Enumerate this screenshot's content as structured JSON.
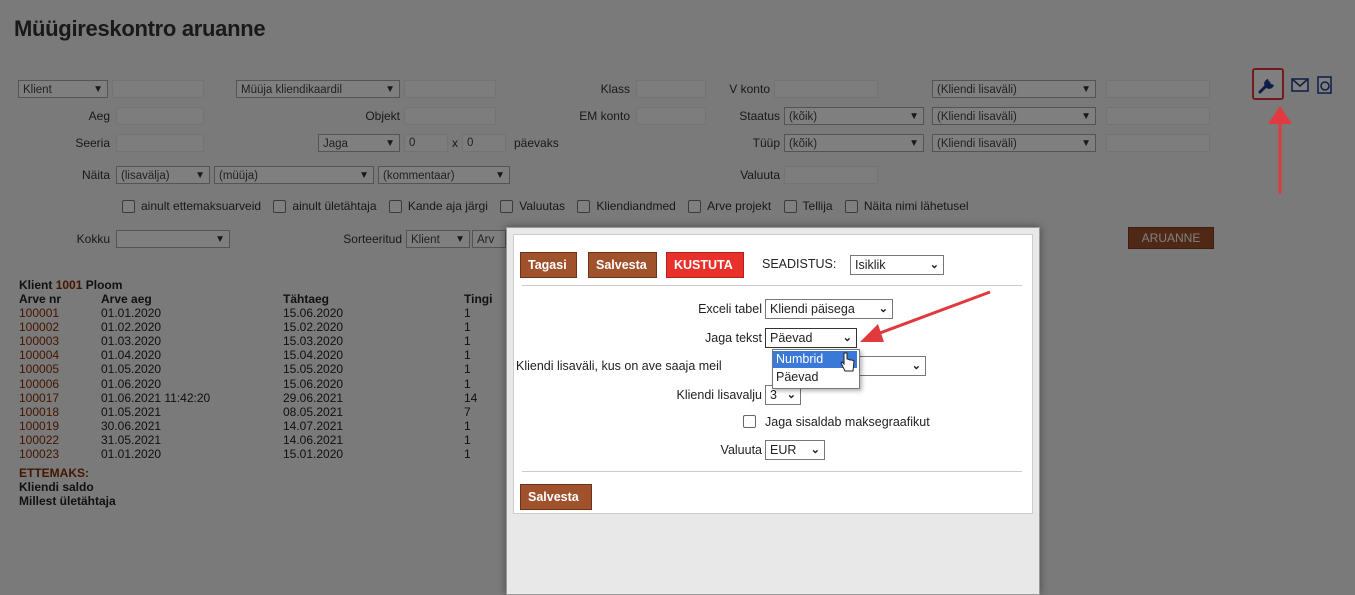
{
  "page": {
    "title": "Müügireskontro aruanne"
  },
  "filters": {
    "row1": {
      "klient_select": "Klient",
      "myyja_select": "Müüja kliendikaardil",
      "klass_label": "Klass",
      "v_konto_label": "V konto",
      "kliendi_lisavali_1": "(Kliendi lisaväli)"
    },
    "row2": {
      "aeg_label": "Aeg",
      "objekt_label": "Objekt",
      "em_konto_label": "EM konto",
      "staatus_label": "Staatus",
      "staatus_value": "(kõik)",
      "kliendi_lisavali_2": "(Kliendi lisaväli)"
    },
    "row3": {
      "seeria_label": "Seeria",
      "jaga_select": "Jaga",
      "jaga_n1": "0",
      "x_label": "x",
      "jaga_n2": "0",
      "paevaks_label": "päevaks",
      "tyyp_label": "Tüüp",
      "tyyp_value": "(kõik)",
      "kliendi_lisavali_3": "(Kliendi lisaväli)"
    },
    "row4": {
      "naita_label": "Näita",
      "lisavalja": "(lisavälja)",
      "myyja": "(müüja)",
      "kommentaar": "(kommentaar)",
      "valuuta_label": "Valuuta"
    },
    "checkboxes": [
      "ainult ettemaksuarveid",
      "ainult ületähtaja",
      "Kande aja järgi",
      "Valuutas",
      "Kliendiandmed",
      "Arve projekt",
      "Tellija",
      "Näita nimi lähetusel"
    ],
    "row6": {
      "kokku_label": "Kokku",
      "sorteeritud_label": "Sorteeritud",
      "sort_value": "Klient",
      "sort_value2": "Arv",
      "aruanne_button": "ARUANNE"
    }
  },
  "report": {
    "client_prefix": "Klient",
    "client_code": "1001",
    "client_name": "Ploom",
    "headers": [
      "Arve nr",
      "Arve aeg",
      "Tähtaeg",
      "Tingi"
    ],
    "rows": [
      {
        "nr": "100001",
        "aeg": "01.01.2020",
        "tahtaeg": "15.06.2020",
        "t": "1"
      },
      {
        "nr": "100002",
        "aeg": "01.02.2020",
        "tahtaeg": "15.02.2020",
        "t": "1"
      },
      {
        "nr": "100003",
        "aeg": "01.03.2020",
        "tahtaeg": "15.03.2020",
        "t": "1"
      },
      {
        "nr": "100004",
        "aeg": "01.04.2020",
        "tahtaeg": "15.04.2020",
        "t": "1"
      },
      {
        "nr": "100005",
        "aeg": "01.05.2020",
        "tahtaeg": "15.05.2020",
        "t": "1"
      },
      {
        "nr": "100006",
        "aeg": "01.06.2020",
        "tahtaeg": "15.06.2020",
        "t": "1"
      },
      {
        "nr": "100017",
        "aeg": "01.06.2021 11:42:20",
        "tahtaeg": "29.06.2021",
        "t": "14"
      },
      {
        "nr": "100018",
        "aeg": "01.05.2021",
        "tahtaeg": "08.05.2021",
        "t": "7"
      },
      {
        "nr": "100019",
        "aeg": "30.06.2021",
        "tahtaeg": "14.07.2021",
        "t": "1"
      },
      {
        "nr": "100022",
        "aeg": "31.05.2021",
        "tahtaeg": "14.06.2021",
        "t": "1"
      },
      {
        "nr": "100023",
        "aeg": "01.01.2020",
        "tahtaeg": "15.01.2020",
        "t": "1"
      }
    ],
    "ettemaks": "ETTEMAKS:",
    "kliendi_saldo": "Kliendi saldo",
    "millest": "Millest ületähtaja"
  },
  "dialog": {
    "tagasi": "Tagasi",
    "salvesta_top": "Salvesta",
    "kustuta": "KUSTUTA",
    "seadistus_label": "SEADISTUS:",
    "seadistus_value": "Isiklik",
    "exceli_label": "Exceli tabel",
    "exceli_value": "Kliendi päisega",
    "jaga_tekst_label": "Jaga tekst",
    "jaga_tekst_value": "Päevad",
    "kliendi_lisavali_label": "Kliendi lisaväli, kus on ave saaja meil",
    "kliendi_lisavalju_label": "Kliendi lisavalju",
    "kliendi_lisavalju_value": "3",
    "jaga_sisaldab_label": "Jaga sisaldab maksegraafikut",
    "valuuta_label": "Valuuta",
    "valuuta_value": "EUR",
    "salvesta_bottom": "Salvesta",
    "dropdown_options": [
      "Numbrid",
      "Päevad"
    ]
  },
  "colors": {
    "brown_button": "#a0522d",
    "red_button": "#e8312b",
    "annotation_red": "#e0393e",
    "highlight_blue": "#3b79d8"
  }
}
